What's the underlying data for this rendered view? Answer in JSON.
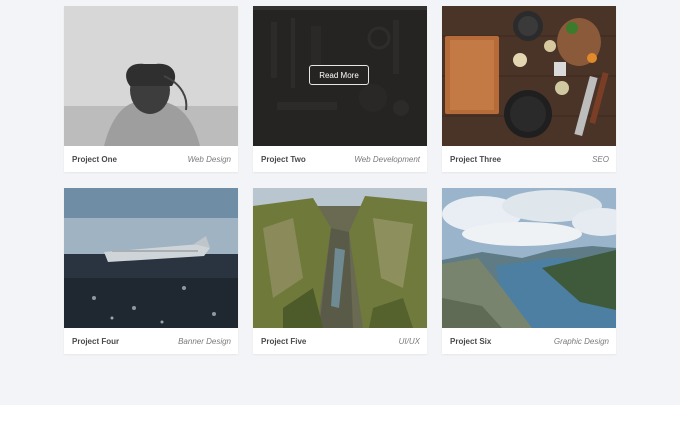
{
  "portfolio": {
    "items": [
      {
        "title": "Project One",
        "category": "Web Design"
      },
      {
        "title": "Project Two",
        "category": "Web Development",
        "hover_button": "Read More"
      },
      {
        "title": "Project Three",
        "category": "SEO"
      },
      {
        "title": "Project Four",
        "category": "Banner Design"
      },
      {
        "title": "Project Five",
        "category": "UI/UX"
      },
      {
        "title": "Project Six",
        "category": "Graphic Design"
      }
    ]
  },
  "colors": {
    "background": "#f3f4f7",
    "card": "#ffffff",
    "title_text": "#4a4a4a",
    "category_text": "#7a7a7a"
  }
}
